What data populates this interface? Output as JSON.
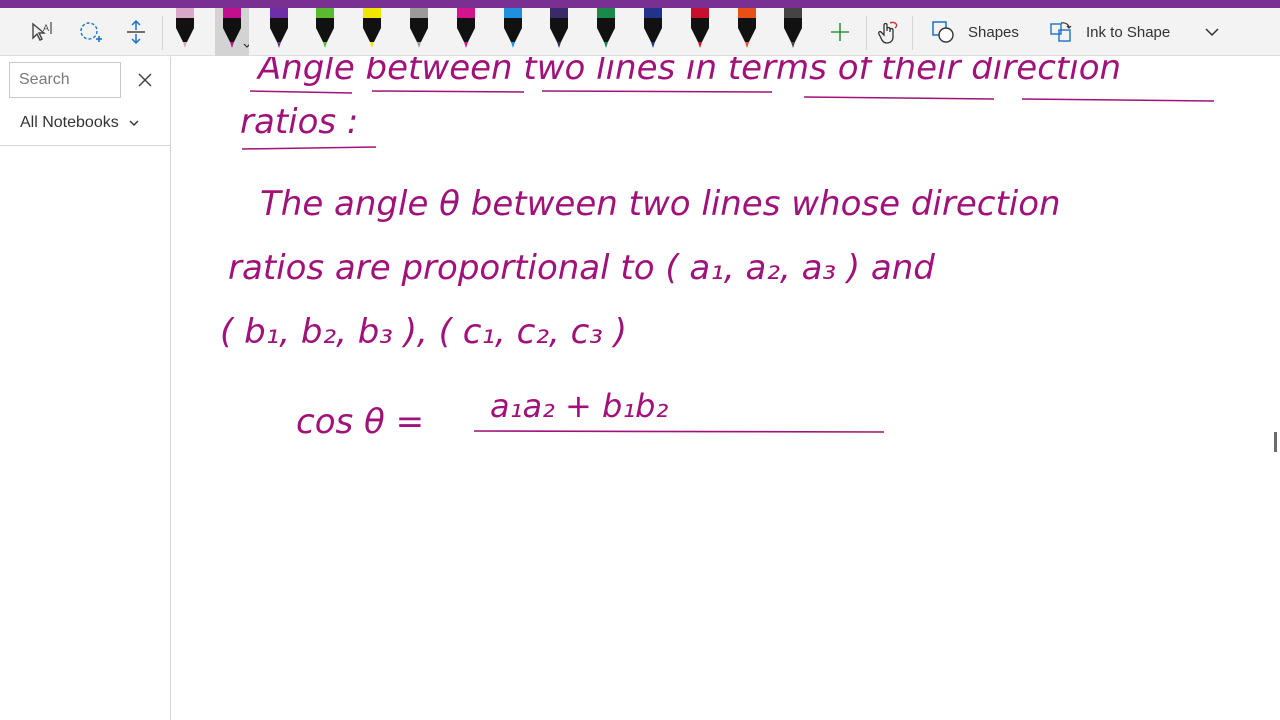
{
  "toolbar": {
    "icons": [
      "ink-to-text-icon",
      "lasso-select-icon",
      "insert-space-icon",
      "add-pen-icon",
      "ink-replay-icon"
    ],
    "pens": [
      {
        "name": "highlighter-yellow-black",
        "color": "#111111",
        "band": "#d9a7c7"
      },
      {
        "name": "pen-magenta",
        "color": "#111111",
        "band": "#c0108f",
        "selected": true
      },
      {
        "name": "pen-purple",
        "color": "#111111",
        "band": "#6f2da8"
      },
      {
        "name": "pen-green",
        "color": "#111111",
        "band": "#5cb82d"
      },
      {
        "name": "highlighter-yellow",
        "color": "#111111",
        "band": "#f2e500"
      },
      {
        "name": "pencil-gray",
        "color": "#111111",
        "band": "#9a9a9a"
      },
      {
        "name": "pen-pink",
        "color": "#111111",
        "band": "#d4148c"
      },
      {
        "name": "pen-blue",
        "color": "#111111",
        "band": "#1f8fde"
      },
      {
        "name": "pen-dark-purple",
        "color": "#111111",
        "band": "#3a2a6a"
      },
      {
        "name": "pen-dark-green",
        "color": "#111111",
        "band": "#1a8a4a"
      },
      {
        "name": "pen-navy",
        "color": "#111111",
        "band": "#22338a"
      },
      {
        "name": "pen-red",
        "color": "#111111",
        "band": "#c8102e"
      },
      {
        "name": "pen-orange",
        "color": "#111111",
        "band": "#e8501a"
      },
      {
        "name": "pen-black",
        "color": "#111111",
        "band": "#444444"
      }
    ],
    "shapes_label": "Shapes",
    "ink_to_shape_label": "Ink to Shape"
  },
  "sidebar": {
    "search_placeholder": "Search",
    "notebooks_label": "All Notebooks"
  },
  "colors": {
    "accent": "#7a2f92",
    "ink": "#a0127a",
    "ribbon_bg": "#f3f3f3"
  },
  "note": {
    "lines": [
      "Angle between two lines in terms of their direction",
      "ratios :",
      "The angle θ between two lines whose direction",
      "ratios are proportional to ( a₁, a₂, a₃ ) and",
      "( b₁, b₂, b₃ ), ( c₁, c₂, c₃ )",
      "cos θ  =",
      "a₁a₂ + b₁b₂"
    ]
  }
}
